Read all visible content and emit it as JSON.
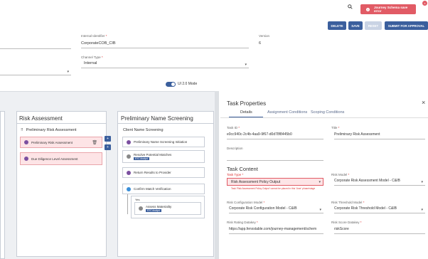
{
  "topbar": {
    "search_icon": "search-icon",
    "toast": {
      "text": "Journey Schema save error",
      "icon": "error-icon",
      "close": "x"
    }
  },
  "actions": {
    "delete": "DELETE",
    "save": "SAVE",
    "reset": "RESET",
    "submit": "SUBMIT FOR APPROVAL"
  },
  "form": {
    "internal_identifier_label": "Internal Identifier",
    "internal_identifier_value": "CorporateCOB_CIB",
    "version_label": "Version",
    "version_value": "6",
    "channel_type_label": "Channel Type",
    "channel_type_value": "Internal",
    "required": "*"
  },
  "mode_toggle": {
    "label": "UI 2.0 Mode",
    "on": true
  },
  "canvas": {
    "risk_assessment": {
      "title": "Risk Assessment",
      "group_title": "Preliminary Risk Assessment",
      "items": [
        {
          "label": "Preliminary Risk Assessment"
        },
        {
          "label": "Due Diligence Level Assessment"
        }
      ]
    },
    "name_screening": {
      "title": "Preliminary Name Screening",
      "group_title": "Client Name Screening",
      "items": [
        {
          "label": "Preliminary Name Screening Initiation",
          "badge": ""
        },
        {
          "label": "Resolve Potential Matches",
          "badge": "KYC Analyst"
        },
        {
          "label": "Return Results to Provider",
          "badge": ""
        },
        {
          "label": "Confirm Match Verification",
          "badge": ""
        }
      ],
      "branch_label": "Yes",
      "sub_item": {
        "label": "Assess Materiality",
        "badge": "KYC Analyst"
      }
    }
  },
  "task_panel": {
    "title": "Task Properties",
    "close": "×",
    "tabs": [
      "Details",
      "Assignment Conditions",
      "Scoping Conditions"
    ],
    "task_id_label": "Task ID",
    "task_id_value": "e0cc940c-2c4b-4aa9-9f67-d0d78f8445b0",
    "title_label": "Title",
    "title_value": "Preliminary Risk Assessment",
    "description_label": "Description",
    "content_title": "Task Content",
    "task_type_label": "Task Type",
    "task_type_value": "Risk Assessment Policy Output",
    "task_type_error": "Task 'Risk Assessment Policy Output' cannot be placed in this 'User' phase/stage",
    "risk_model_label": "Risk Model",
    "risk_model_value": "Corporate Risk Assessment Model - C&IB",
    "risk_config_label": "Risk Configuration Model",
    "risk_config_value": "Corporate Risk Configuration Model - C&IB",
    "risk_threshold_label": "Risk Threshold Model",
    "risk_threshold_value": "Corporate Risk Threshold Model - C&IB",
    "risk_rating_label": "Risk Rating Datakey",
    "risk_rating_value": "https://app.fenxstable.com/journey-management/schem",
    "risk_score_label": "Risk Score Datakey",
    "risk_score_value": "riskScore"
  },
  "colors": {
    "primary": "#3b5f9d",
    "error": "#e15b65",
    "error_bg": "#fde4e6",
    "canvas_bg": "#eef0f3"
  }
}
